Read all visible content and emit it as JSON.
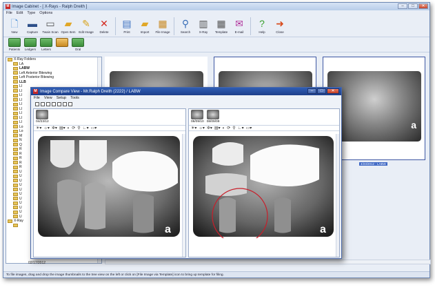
{
  "app": {
    "title": "Image Cabinet - [ X-Rays - Ralph Dreith ]",
    "menu": [
      "File",
      "Edit",
      "Type",
      "Options"
    ]
  },
  "toolbar": [
    {
      "label": "New",
      "icon": "new-file-icon",
      "glyph": "🗋",
      "color": "#4a8fd6"
    },
    {
      "label": "Capture",
      "icon": "camera-icon",
      "glyph": "▬",
      "color": "#2d4f8a"
    },
    {
      "label": "Twain Scan",
      "icon": "scanner-icon",
      "glyph": "▭",
      "color": "#555555"
    },
    {
      "label": "Open Item",
      "icon": "open-folder-icon",
      "glyph": "▰",
      "color": "#e0a728"
    },
    {
      "label": "Edit Image",
      "icon": "pencil-icon",
      "glyph": "✎",
      "color": "#d8a21a"
    },
    {
      "label": "Delete",
      "icon": "delete-x-icon",
      "glyph": "✕",
      "color": "#d32a1f"
    },
    {
      "label": "Print",
      "icon": "printer-icon",
      "glyph": "▤",
      "color": "#3b6fc0"
    },
    {
      "label": "Import",
      "icon": "import-folder-icon",
      "glyph": "▰",
      "color": "#e0a728"
    },
    {
      "label": "File Image",
      "icon": "file-image-icon",
      "glyph": "▦",
      "color": "#c98a23"
    },
    {
      "label": "Search",
      "icon": "search-icon",
      "glyph": "⚲",
      "color": "#3a6fb8"
    },
    {
      "label": "X-Ray",
      "icon": "xray-icon",
      "glyph": "▥",
      "color": "#555555"
    },
    {
      "label": "Template",
      "icon": "template-icon",
      "glyph": "▦",
      "color": "#555555"
    },
    {
      "label": "E-mail",
      "icon": "email-icon",
      "glyph": "✉",
      "color": "#b0309a"
    },
    {
      "label": "Help",
      "icon": "help-icon",
      "glyph": "?",
      "color": "#3aa12e"
    },
    {
      "label": "Close",
      "icon": "exit-icon",
      "glyph": "➜",
      "color": "#d84a1b"
    }
  ],
  "subtoolbar": [
    {
      "label": "Patients",
      "selected": false
    },
    {
      "label": "Ledgers",
      "selected": false
    },
    {
      "label": "Letters",
      "selected": false
    },
    {
      "label": "",
      "selected": true
    },
    {
      "label": "Oral",
      "selected": false
    }
  ],
  "tree": {
    "items": [
      {
        "label": "X-Ray Folders",
        "bold": false,
        "indent": 0
      },
      {
        "label": "LA",
        "bold": false,
        "indent": 1
      },
      {
        "label": "LABW",
        "bold": true,
        "indent": 1
      },
      {
        "label": "Left Anterior Bitewing",
        "bold": false,
        "indent": 1
      },
      {
        "label": "Left Posterior Bitewing",
        "bold": false,
        "indent": 1
      },
      {
        "label": "LLB",
        "bold": true,
        "indent": 1
      },
      {
        "label": "LI",
        "bold": false,
        "indent": 1
      },
      {
        "label": "LI",
        "bold": false,
        "indent": 1
      },
      {
        "label": "LI",
        "bold": false,
        "indent": 1
      },
      {
        "label": "LI",
        "bold": false,
        "indent": 1
      },
      {
        "label": "LI",
        "bold": false,
        "indent": 1
      },
      {
        "label": "LI",
        "bold": false,
        "indent": 1
      },
      {
        "label": "LI",
        "bold": false,
        "indent": 1
      },
      {
        "label": "LI",
        "bold": false,
        "indent": 1
      },
      {
        "label": "LI",
        "bold": false,
        "indent": 1
      },
      {
        "label": "Lo",
        "bold": false,
        "indent": 1
      },
      {
        "label": "Lo",
        "bold": false,
        "indent": 1
      },
      {
        "label": "M",
        "bold": false,
        "indent": 1
      },
      {
        "label": "N",
        "bold": false,
        "indent": 1
      },
      {
        "label": "Q",
        "bold": false,
        "indent": 1
      },
      {
        "label": "R",
        "bold": false,
        "indent": 1
      },
      {
        "label": "R",
        "bold": false,
        "indent": 1
      },
      {
        "label": "R",
        "bold": false,
        "indent": 1
      },
      {
        "label": "R",
        "bold": false,
        "indent": 1
      },
      {
        "label": "R",
        "bold": false,
        "indent": 1
      },
      {
        "label": "U",
        "bold": false,
        "indent": 1
      },
      {
        "label": "U",
        "bold": false,
        "indent": 1
      },
      {
        "label": "U",
        "bold": false,
        "indent": 1
      },
      {
        "label": "U",
        "bold": false,
        "indent": 1
      },
      {
        "label": "U",
        "bold": false,
        "indent": 1
      },
      {
        "label": "U",
        "bold": false,
        "indent": 1
      },
      {
        "label": "U",
        "bold": false,
        "indent": 1
      },
      {
        "label": "U",
        "bold": false,
        "indent": 1
      },
      {
        "label": "U",
        "bold": false,
        "indent": 1
      },
      {
        "label": "U",
        "bold": false,
        "indent": 1
      },
      {
        "label": "U",
        "bold": false,
        "indent": 1
      },
      {
        "label": "X-Ray",
        "bold": false,
        "indent": 0
      },
      {
        "label": "",
        "bold": false,
        "indent": 1
      }
    ],
    "date": "02/17/2012"
  },
  "gallery": {
    "selected_label": "4/23/2012 - LABW",
    "badge": "a"
  },
  "compare": {
    "title": "Image Compare View - Mr.Ralph Dreith (2222) / LABW",
    "menu": [
      "File",
      "View",
      "Setup",
      "Tools"
    ],
    "left": {
      "thumbs": [
        "04/23/12"
      ],
      "badge": "a"
    },
    "right": {
      "thumbs": [
        "08/09/10",
        "08/09/09"
      ],
      "badge": "a"
    }
  },
  "status": "To file images, drag and drop the image thumbnails to the tree view on the left or click on [File Image via Template] icon to bring up template for filing."
}
